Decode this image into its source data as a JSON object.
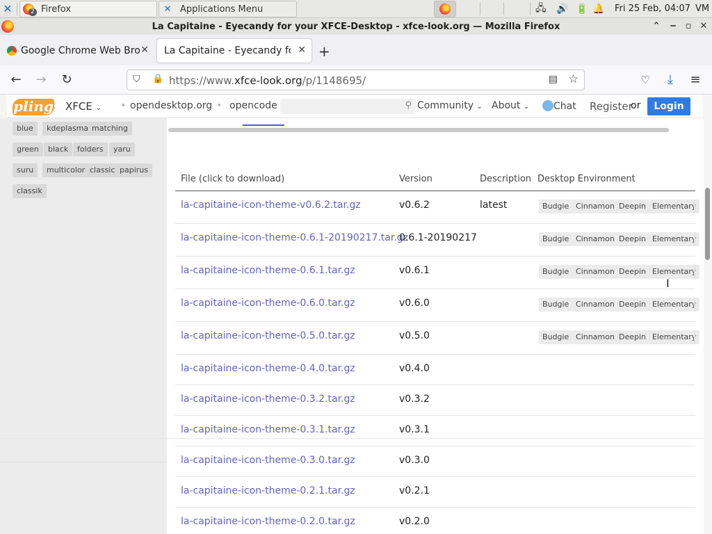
{
  "panel": {
    "task_firefox": "Firefox",
    "task_firefox_badge": "2",
    "task_apps": "Applications Menu",
    "clock": "Fri 25 Feb, 04:07",
    "vm": "VM"
  },
  "window": {
    "title": "La Capitaine - Eyecandy for your XFCE-Desktop - xfce-look.org — Mozilla Firefox"
  },
  "tabs": [
    {
      "label": "Google Chrome Web Browser"
    },
    {
      "label": "La Capitaine - Eyecandy for your XFCE-Desktop"
    }
  ],
  "urlbar": {
    "prefix": "https://www.",
    "domain": "xfce-look.org",
    "path": "/p/1148695/"
  },
  "site_header": {
    "logo": "pling",
    "category": "XFCE",
    "links": [
      "opendesktop.org",
      "opencode"
    ],
    "community": "Community",
    "about": "About",
    "chat": "Chat",
    "register": "Register",
    "or": "or",
    "login": "Login"
  },
  "tags": [
    "blue",
    "kdeplasma",
    "matching",
    "green",
    "black",
    "folders",
    "yaru",
    "suru",
    "multicolor",
    "classic",
    "papirus",
    "classik"
  ],
  "table": {
    "headers": [
      "File (click to download)",
      "Version",
      "Description",
      "Desktop Environment"
    ],
    "rows": [
      {
        "file": "la-capitaine-icon-theme-v0.6.2.tar.gz",
        "version": "v0.6.2",
        "description": "latest",
        "de": [
          "Budgie",
          "Cinnamon",
          "Deepin",
          "Elementary"
        ]
      },
      {
        "file": "la-capitaine-icon-theme-0.6.1-20190217.tar.gz",
        "version": "0.6.1-20190217",
        "description": "",
        "de": [
          "Budgie",
          "Cinnamon",
          "Deepin",
          "Elementary"
        ]
      },
      {
        "file": "la-capitaine-icon-theme-0.6.1.tar.gz",
        "version": "v0.6.1",
        "description": "",
        "de": [
          "Budgie",
          "Cinnamon",
          "Deepin",
          "Elementary"
        ]
      },
      {
        "file": "la-capitaine-icon-theme-0.6.0.tar.gz",
        "version": "v0.6.0",
        "description": "",
        "de": [
          "Budgie",
          "Cinnamon",
          "Deepin",
          "Elementary"
        ]
      },
      {
        "file": "la-capitaine-icon-theme-0.5.0.tar.gz",
        "version": "v0.5.0",
        "description": "",
        "de": [
          "Budgie",
          "Cinnamon",
          "Deepin",
          "Elementary"
        ]
      },
      {
        "file": "la-capitaine-icon-theme-0.4.0.tar.gz",
        "version": "v0.4.0",
        "description": "",
        "de": []
      },
      {
        "file": "la-capitaine-icon-theme-0.3.2.tar.gz",
        "version": "v0.3.2",
        "description": "",
        "de": []
      },
      {
        "file": "la-capitaine-icon-theme-0.3.1.tar.gz",
        "version": "v0.3.1",
        "description": "",
        "de": []
      },
      {
        "file": "la-capitaine-icon-theme-0.3.0.tar.gz",
        "version": "v0.3.0",
        "description": "",
        "de": []
      },
      {
        "file": "la-capitaine-icon-theme-0.2.1.tar.gz",
        "version": "v0.2.1",
        "description": "",
        "de": []
      },
      {
        "file": "la-capitaine-icon-theme-0.2.0.tar.gz",
        "version": "v0.2.0",
        "description": "",
        "de": []
      }
    ]
  },
  "colors": {
    "link": "#6262c7",
    "login_button": "#2f7be6",
    "pling_logo": "#f5a030"
  }
}
